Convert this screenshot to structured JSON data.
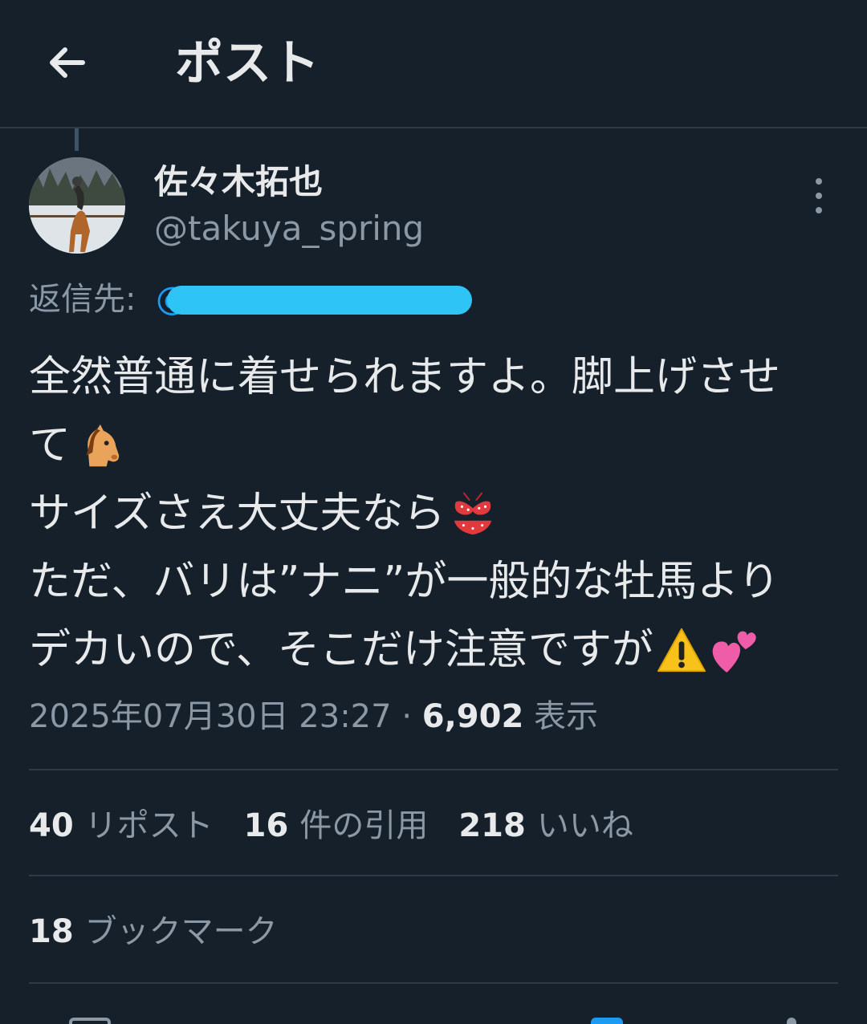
{
  "header": {
    "back_icon": "arrow-left-icon",
    "title": "ポスト"
  },
  "author": {
    "display_name": "佐々木拓也",
    "handle": "@takuya_spring",
    "avatar_icon": "horse-rider-avatar",
    "more_icon": "more-vertical-icon"
  },
  "reply": {
    "label": "返信先:",
    "at_symbol": "@",
    "target_redacted": true
  },
  "tweet": {
    "line1": "全然普通に着せられますよ。脚上げさせ",
    "line2": "て",
    "line3": "サイズさえ大丈夫なら",
    "line4": "ただ、バリは”ナニ”が一般的な牡馬より",
    "line5": "デカいので、そこだけ注意ですが",
    "emoji_horse": "horse-face-emoji",
    "emoji_bikini": "bikini-emoji",
    "emoji_warning": "warning-emoji",
    "emoji_hearts": "two-hearts-emoji"
  },
  "meta": {
    "timestamp": "2025年07月30日 23:27",
    "separator": "·",
    "views_count": "6,902",
    "views_label": "表示"
  },
  "stats": {
    "reposts_count": "40",
    "reposts_label": "リポスト",
    "quotes_count": "16",
    "quotes_label": "件の引用",
    "likes_count": "218",
    "likes_label": "いいね",
    "bookmarks_count": "18",
    "bookmarks_label": "ブックマーク"
  },
  "colors": {
    "background": "#15202b",
    "primary_text": "#e7e9ea",
    "secondary_text": "#8b98a5",
    "link": "#1d9bf0",
    "divider": "#2f3b47"
  }
}
